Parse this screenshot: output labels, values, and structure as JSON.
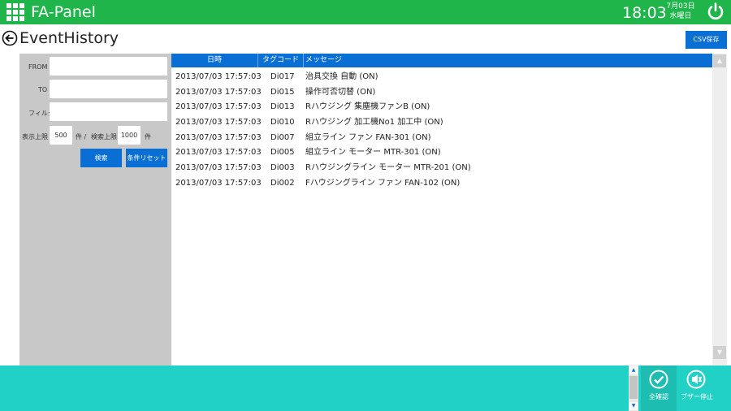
{
  "header": {
    "app_title": "FA-Panel",
    "time": "18:03",
    "date": "7月03日",
    "weekday": "水曜日"
  },
  "page": {
    "title": "EventHistory",
    "csv_label": "CSV保存"
  },
  "filter": {
    "from_label": "FROM",
    "from_value": "",
    "to_label": "TO",
    "to_value": "",
    "filter_label": "フィルタ",
    "filter_value": "",
    "display_limit_label": "表示上限",
    "display_limit_value": "500",
    "unit_label": "件 /",
    "search_limit_label": "検索上限",
    "search_limit_value": "1000",
    "unit_label2": "件",
    "search_button": "検索",
    "reset_button": "条件リセット"
  },
  "table": {
    "columns": [
      "日時",
      "タグコード",
      "メッセージ"
    ],
    "rows": [
      [
        "2013/07/03 17:57:03",
        "Di017",
        "治具交換  自動 (ON)"
      ],
      [
        "2013/07/03 17:57:03",
        "Di015",
        "操作可否切替 (ON)"
      ],
      [
        "2013/07/03 17:57:03",
        "Di013",
        "Rハウジング  集塵機ファンB (ON)"
      ],
      [
        "2013/07/03 17:57:03",
        "Di010",
        "Rハウジング  加工機No1  加工中 (ON)"
      ],
      [
        "2013/07/03 17:57:03",
        "Di007",
        "組立ライン  ファン  FAN-301 (ON)"
      ],
      [
        "2013/07/03 17:57:03",
        "Di005",
        "組立ライン  モーター  MTR-301 (ON)"
      ],
      [
        "2013/07/03 17:57:03",
        "Di003",
        "Rハウジングライン  モーター  MTR-201 (ON)"
      ],
      [
        "2013/07/03 17:57:03",
        "Di002",
        "Fハウジングライン  ファン  FAN-102 (ON)"
      ]
    ]
  },
  "footer": {
    "confirm_all": "全確認",
    "buzzer_stop": "ブザー停止"
  },
  "colors": {
    "topbar": "#1fb54a",
    "accent": "#0a6fd4",
    "footer": "#22d1c5",
    "panel": "#c8c8c8"
  },
  "icons": [
    "apps-grid-icon",
    "power-icon",
    "back-arrow-icon",
    "scroll-up-icon",
    "scroll-down-icon",
    "check-circle-icon",
    "buzzer-stop-icon"
  ]
}
